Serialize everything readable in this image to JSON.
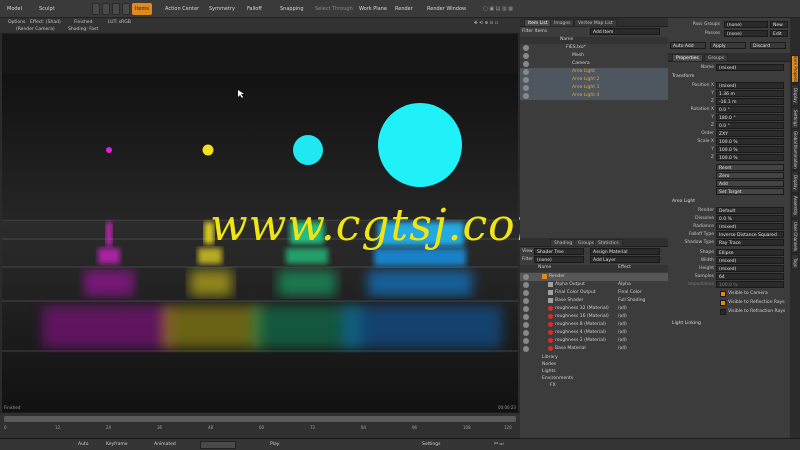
{
  "toolbar": {
    "items": [
      "Model",
      "Sculpt",
      "Items",
      "Action Center",
      "Symmetry",
      "Falloff",
      "Snapping",
      "Select Through",
      "Work Plane",
      "Render",
      "Render Window"
    ]
  },
  "viewport_bar": {
    "row1": [
      "Options",
      "Effect: (Shad)",
      "Finished",
      "LUT: sRGB"
    ],
    "row2": [
      "(Render Camera)",
      "Shading: Fast"
    ]
  },
  "viewport": {
    "status_left": "Finished",
    "status_right": "00:00:23",
    "watermark": "www.cgtsj.com",
    "light_colors": [
      "#e020d8",
      "#f0e020",
      "#20d890",
      "#20e8f0"
    ]
  },
  "timeline": {
    "ticks": [
      "0",
      "12",
      "24",
      "36",
      "48",
      "60",
      "72",
      "84",
      "96",
      "108",
      "120"
    ]
  },
  "bottombar": {
    "items": [
      "Auto",
      "Keyframe",
      "Animated",
      "Play",
      "Settings"
    ]
  },
  "item_list": {
    "tabs": [
      "Item List",
      "Images",
      "Vertex Map List"
    ],
    "filter_label": "Filter Items",
    "add_item": "Add Item",
    "column_name": "Name",
    "rows": [
      {
        "label": "FIES.lxo*",
        "highlight": false,
        "indent": 0
      },
      {
        "label": "Mesh",
        "highlight": false,
        "indent": 1
      },
      {
        "label": "Camera",
        "highlight": false,
        "indent": 1
      },
      {
        "label": "Area Light",
        "highlight": true,
        "indent": 1
      },
      {
        "label": "Area Light 2",
        "highlight": true,
        "indent": 1
      },
      {
        "label": "Area Light 3",
        "highlight": true,
        "indent": 1
      },
      {
        "label": "Area Light 4",
        "highlight": true,
        "indent": 1
      }
    ]
  },
  "shader_tree": {
    "tabs": [
      "Shading",
      "Groups",
      "Statistics"
    ],
    "view_label": "View",
    "view_value": "Shader Tree",
    "assign_material": "Assign Material",
    "filter_label": "Filter",
    "filter_value": "(none)",
    "add_layer": "Add Layer",
    "col_name": "Name",
    "col_effect": "Effect",
    "rows": [
      {
        "name": "Render",
        "effect": "",
        "indent": 0,
        "color": "#e08a1e"
      },
      {
        "name": "Alpha Output",
        "effect": "Alpha",
        "indent": 1,
        "color": "#a0a0a0"
      },
      {
        "name": "Final Color Output",
        "effect": "Final Color",
        "indent": 1,
        "color": "#a0a0a0"
      },
      {
        "name": "Base Shader",
        "effect": "Full Shading",
        "indent": 1,
        "color": "#a0a0a0"
      },
      {
        "name": "roughness 32 (Material)",
        "effect": "(all)",
        "indent": 1,
        "color": "#d03030"
      },
      {
        "name": "roughness 16 (Material)",
        "effect": "(all)",
        "indent": 1,
        "color": "#d03030"
      },
      {
        "name": "roughness 8 (Material)",
        "effect": "(all)",
        "indent": 1,
        "color": "#d03030"
      },
      {
        "name": "roughness 4 (Material)",
        "effect": "(all)",
        "indent": 1,
        "color": "#d03030"
      },
      {
        "name": "roughness 2 (Material)",
        "effect": "(all)",
        "indent": 1,
        "color": "#d03030"
      },
      {
        "name": "Base Material",
        "effect": "(all)",
        "indent": 1,
        "color": "#d03030"
      }
    ],
    "tree": [
      "Library",
      "Nodes",
      "Lights",
      "Environments",
      "FX"
    ]
  },
  "properties": {
    "pass_groups_label": "Pass Groups",
    "pass_groups_value": "(none)",
    "passes_label": "Passes",
    "passes_value": "(none)",
    "new_btn": "New",
    "edit_btn": "Edit",
    "auto_add": "Auto Add",
    "apply": "Apply",
    "discard": "Discard",
    "tabs": [
      "Properties",
      "Groups"
    ],
    "name_label": "Name",
    "name_value": "(mixed)",
    "transform_header": "Transform",
    "transform_rows": [
      {
        "label": "Position X",
        "value": "(mixed)"
      },
      {
        "label": "Y",
        "value": "1.36 m"
      },
      {
        "label": "Z",
        "value": "-16.1 m"
      },
      {
        "label": "Rotation X",
        "value": "0.0 °"
      },
      {
        "label": "Y",
        "value": "180.0 °"
      },
      {
        "label": "Z",
        "value": "0.0 °"
      },
      {
        "label": "Order",
        "value": "ZXY"
      },
      {
        "label": "Scale X",
        "value": "100.0 %"
      },
      {
        "label": "Y",
        "value": "100.0 %"
      },
      {
        "label": "Z",
        "value": "100.0 %"
      }
    ],
    "transform_buttons": [
      "Reset",
      "Zero",
      "Add",
      "Set Target"
    ],
    "area_light_header": "Area Light",
    "area_rows": [
      {
        "label": "Render",
        "value": "Default"
      },
      {
        "label": "Dissolve",
        "value": "0.0 %"
      },
      {
        "label": "Radiance",
        "value": "(mixed)"
      },
      {
        "label": "Falloff Type",
        "value": "Inverse Distance Squared"
      },
      {
        "label": "Shadow Type",
        "value": "Ray Trace"
      },
      {
        "label": "Shape",
        "value": "Ellipse"
      },
      {
        "label": "Width",
        "value": "(mixed)"
      },
      {
        "label": "Height",
        "value": "(mixed)"
      },
      {
        "label": "Samples",
        "value": "64"
      },
      {
        "label": "Importance",
        "value": "100.0 %"
      }
    ],
    "checks": [
      {
        "label": "Visible to Camera",
        "checked": true
      },
      {
        "label": "Visible to Reflection Rays",
        "checked": true
      },
      {
        "label": "Visible to Refraction Rays",
        "checked": false
      }
    ],
    "light_linking": "Light Linking",
    "side_tabs": [
      "Item Properties",
      "Display",
      "Settings",
      "Global Illumination",
      "Display",
      "Assembly",
      "User Channels",
      "Tags"
    ]
  }
}
